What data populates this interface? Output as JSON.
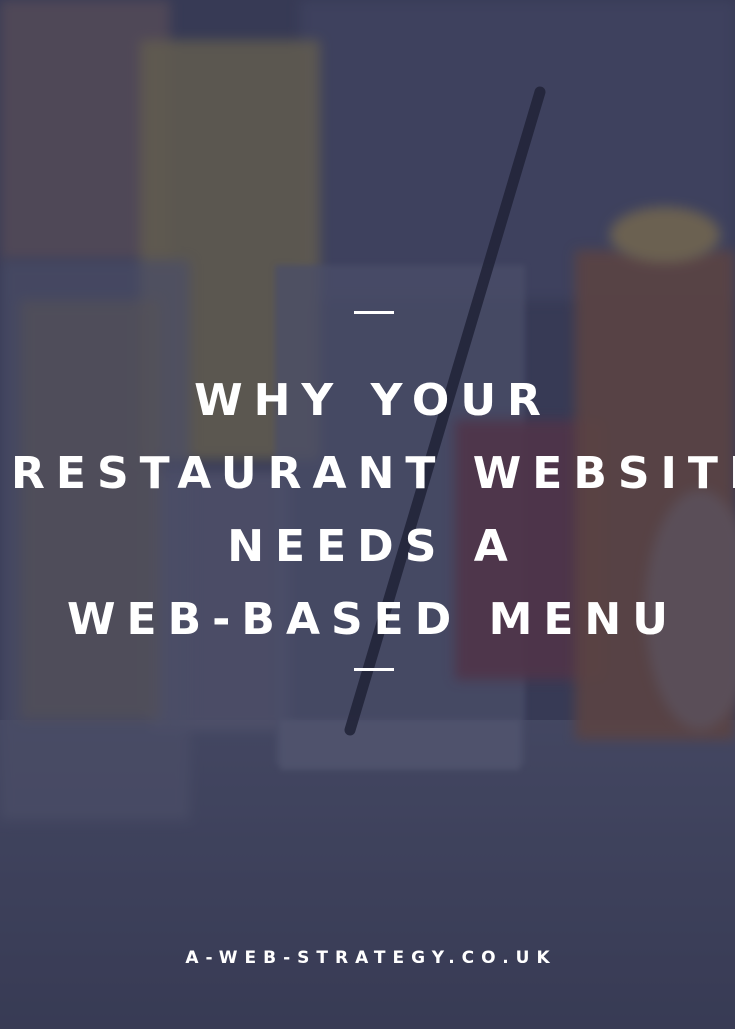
{
  "headline": {
    "lines": [
      "WHY YOUR",
      "RESTAURANT WEBSITE",
      "NEEDS A",
      "WEB-BASED MENU"
    ]
  },
  "footer": {
    "site_url": "A-WEB-STRATEGY.CO.UK"
  },
  "colors": {
    "overlay": "#2c2e48",
    "text": "#ffffff"
  },
  "background_image": {
    "subject": "drinks glasses with straw on a table"
  }
}
